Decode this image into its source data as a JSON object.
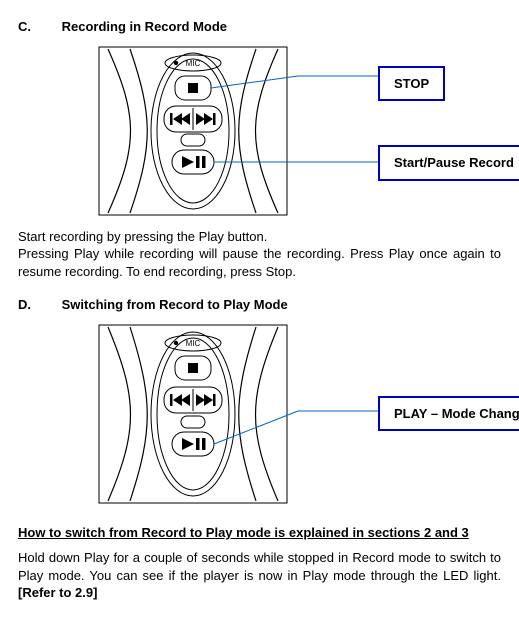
{
  "sectionC": {
    "letter": "C.",
    "title": "Recording in Record Mode",
    "callouts": {
      "stop": "STOP",
      "start": "Start/Pause Record"
    },
    "para1": "Start recording by pressing the Play button.",
    "para2": "Pressing Play while recording will pause the recording. Press Play once again to resume recording. To end recording, press Stop."
  },
  "sectionD": {
    "letter": "D.",
    "title": "Switching from Record to Play Mode",
    "callouts": {
      "play": "PLAY – Mode Change"
    },
    "subheading": "How to switch from Record to Play mode is explained in sections 2 and 3",
    "para1_a": "Hold down Play for a couple of seconds while stopped in Record mode to switch to Play mode. You can see if the player is now in Play mode through the LED light. ",
    "para1_b": "[Refer to 2.9]"
  },
  "device": {
    "micLabel": "MIC"
  }
}
